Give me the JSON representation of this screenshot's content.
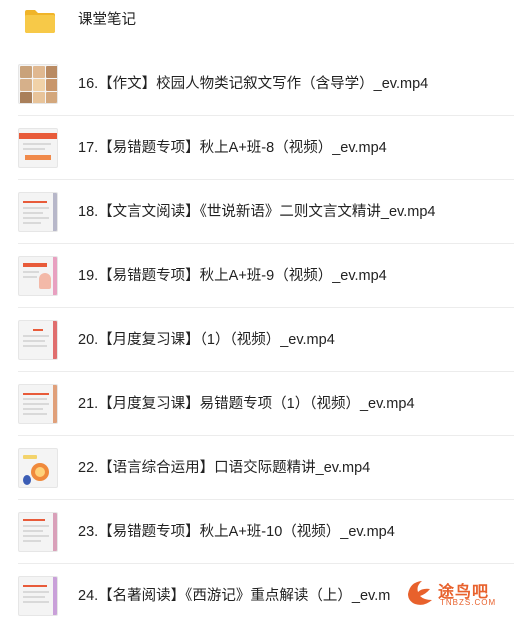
{
  "folder": {
    "name": "课堂笔记",
    "icon": "folder-icon"
  },
  "files": [
    {
      "name": "16.【作文】校园人物类记叙文写作（含导学）_ev.mp4",
      "icon": "video-thumbnail"
    },
    {
      "name": "17.【易错题专项】秋上A+班-8（视频）_ev.mp4",
      "icon": "video-thumbnail"
    },
    {
      "name": "18.【文言文阅读】《世说新语》二则文言文精讲_ev.mp4",
      "icon": "video-thumbnail"
    },
    {
      "name": "19.【易错题专项】秋上A+班-9（视频）_ev.mp4",
      "icon": "video-thumbnail"
    },
    {
      "name": "20.【月度复习课】（1）（视频）_ev.mp4",
      "icon": "video-thumbnail"
    },
    {
      "name": "21.【月度复习课】易错题专项（1）（视频）_ev.mp4",
      "icon": "video-thumbnail"
    },
    {
      "name": "22.【语言综合运用】口语交际题精讲_ev.mp4",
      "icon": "video-thumbnail"
    },
    {
      "name": "23.【易错题专项】秋上A+班-10（视频）_ev.mp4",
      "icon": "video-thumbnail"
    },
    {
      "name": "24.【名著阅读】《西游记》重点解读（上）_ev.m",
      "icon": "video-thumbnail"
    }
  ],
  "watermark": {
    "text": "途鸟吧",
    "sub": "TNBZS.COM",
    "color": "#e8612c"
  },
  "colors": {
    "folder": "#f7c948",
    "folder_dark": "#f0b429",
    "divider": "#ececec",
    "text": "#222222"
  }
}
